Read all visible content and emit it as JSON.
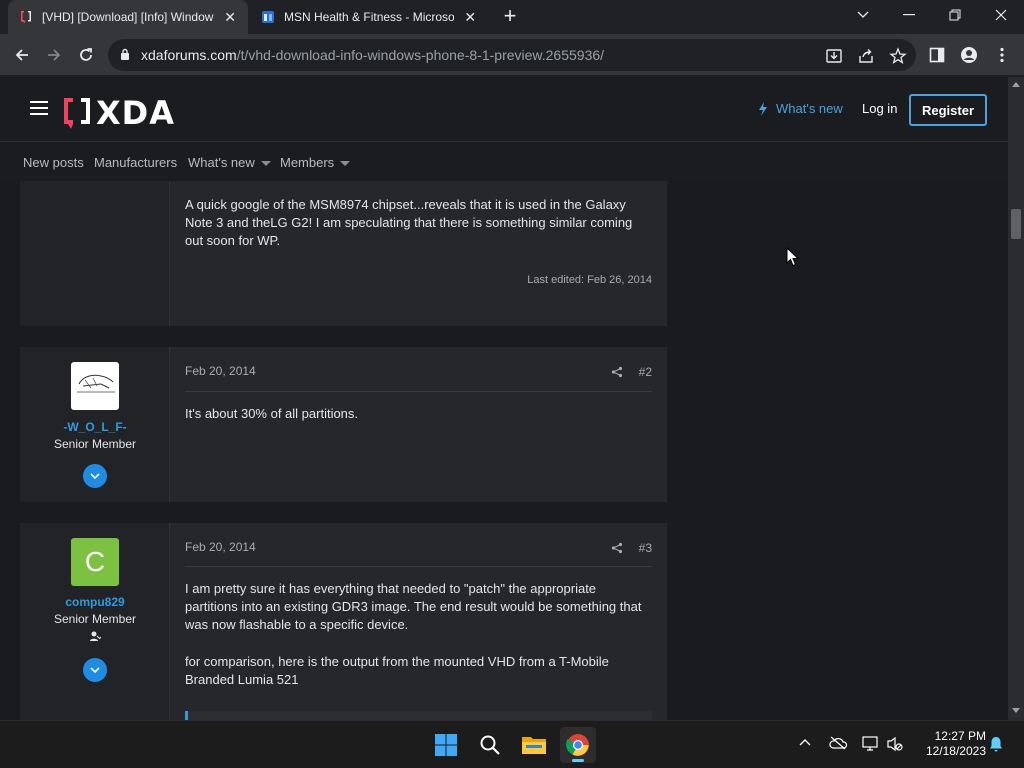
{
  "browser": {
    "tabs": [
      {
        "title": "[VHD] [Download] [Info] Window",
        "close": "✕"
      },
      {
        "title": "MSN Health & Fitness - Microsof",
        "close": "✕"
      }
    ],
    "new_tab": "+",
    "url_host": "xdaforums.com",
    "url_path": "/t/vhd-download-info-windows-phone-8-1-preview.2655936/"
  },
  "header": {
    "logo_text": "XDA",
    "whats_new": "What's new",
    "login": "Log in",
    "register": "Register"
  },
  "subnav": {
    "items": [
      "New posts",
      "Manufacturers",
      "What's new",
      "Members"
    ]
  },
  "posts": [
    {
      "text": "A quick google of the MSM8974 chipset...reveals that it is used in the Galaxy Note 3 and theLG G2! I am speculating that there is something similar coming out soon for WP.",
      "last_edited": "Last edited: Feb 26, 2014"
    },
    {
      "date": "Feb 20, 2014",
      "number": "#2",
      "username": "-W_O_L_F-",
      "role": "Senior Member",
      "text": "It's about 30% of all partitions."
    },
    {
      "date": "Feb 20, 2014",
      "number": "#3",
      "username": "compu829",
      "avatar_letter": "C",
      "avatar_color": "#7dc142",
      "role": "Senior Member",
      "text_p1": "I am pretty sure it has everything that needed to \"patch\" the appropriate partitions into an existing GDR3 image. The end result would be something that was now flashable to a specific device.",
      "text_p2": "for comparison, here is the output from the mounted VHD from a T-Mobile Branded Lumia 521"
    }
  ],
  "taskbar": {
    "time": "12:27 PM",
    "date": "12/18/2023"
  },
  "colors": {
    "accent": "#2e9be0",
    "register_border": "#4aa3df",
    "page_bg": "#1a1b1e",
    "post_bg": "#26272b"
  }
}
